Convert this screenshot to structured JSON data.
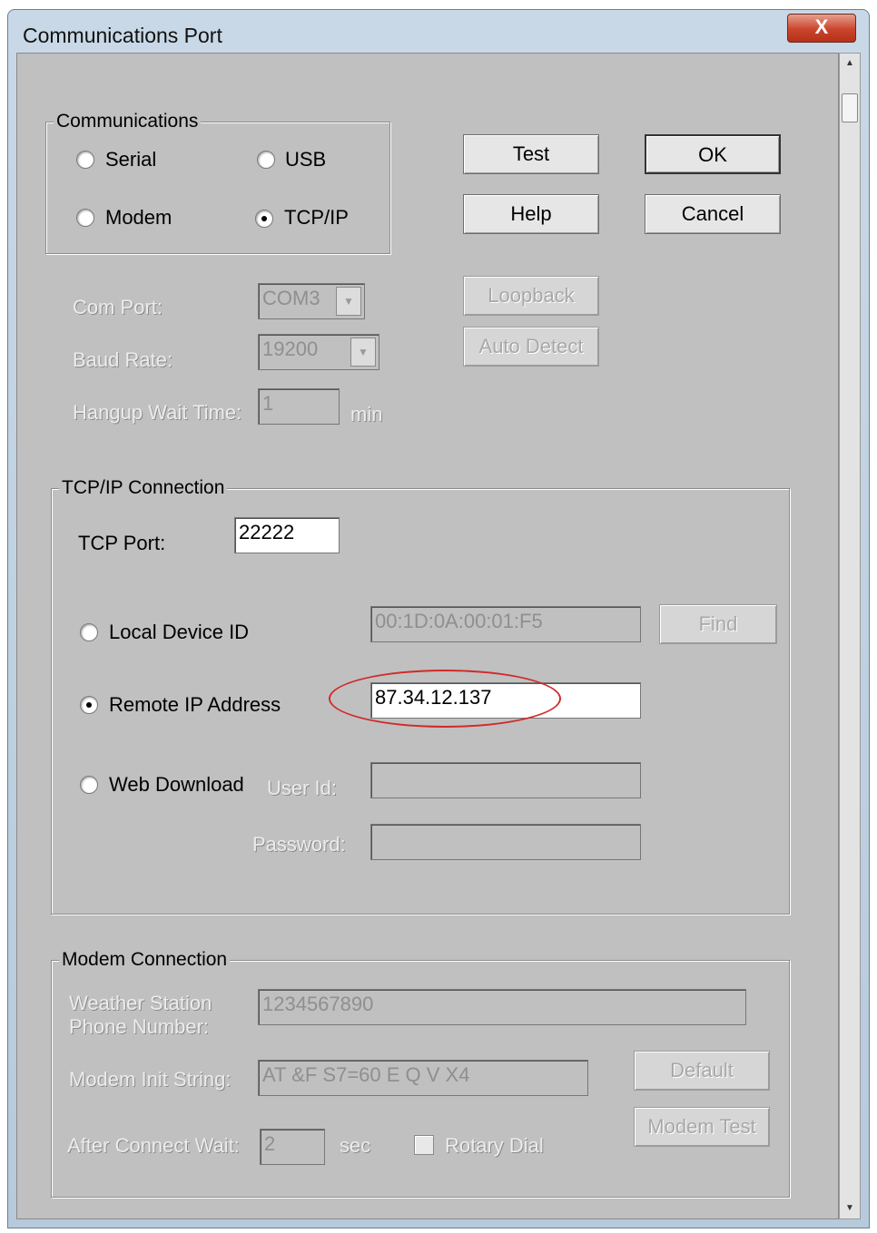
{
  "window": {
    "title": "Communications Port",
    "close_label": "X"
  },
  "communications": {
    "label": "Communications",
    "options": {
      "serial": "Serial",
      "usb": "USB",
      "modem": "Modem",
      "tcpip": "TCP/IP"
    },
    "selected": "TCP/IP"
  },
  "buttons": {
    "test": "Test",
    "ok": "OK",
    "help": "Help",
    "cancel": "Cancel",
    "loopback": "Loopback",
    "auto_detect": "Auto Detect",
    "find": "Find",
    "default": "Default",
    "modem_test": "Modem Test"
  },
  "serial": {
    "com_port_label": "Com Port:",
    "com_port_value": "COM3",
    "baud_rate_label": "Baud Rate:",
    "baud_rate_value": "19200",
    "hangup_label": "Hangup Wait Time:",
    "hangup_value": "1",
    "hangup_unit": "min"
  },
  "tcpip": {
    "label": "TCP/IP Connection",
    "tcp_port_label": "TCP Port:",
    "tcp_port_value": "22222",
    "local_device_label": "Local Device ID",
    "local_device_value": "00:1D:0A:00:01:F5",
    "remote_ip_label": "Remote IP Address",
    "remote_ip_value": "87.34.12.137",
    "web_download_label": "Web Download",
    "user_id_label": "User Id:",
    "user_id_value": "",
    "password_label": "Password:",
    "password_value": "",
    "selected": "Remote IP Address"
  },
  "modem": {
    "label": "Modem Connection",
    "phone_label_1": "Weather Station",
    "phone_label_2": "Phone Number:",
    "phone_value": "1234567890",
    "init_label": "Modem Init String:",
    "init_value": "AT &F S7=60 E Q V X4",
    "wait_label": "After Connect Wait:",
    "wait_value": "2",
    "wait_unit": "sec",
    "rotary_label": "Rotary Dial"
  }
}
